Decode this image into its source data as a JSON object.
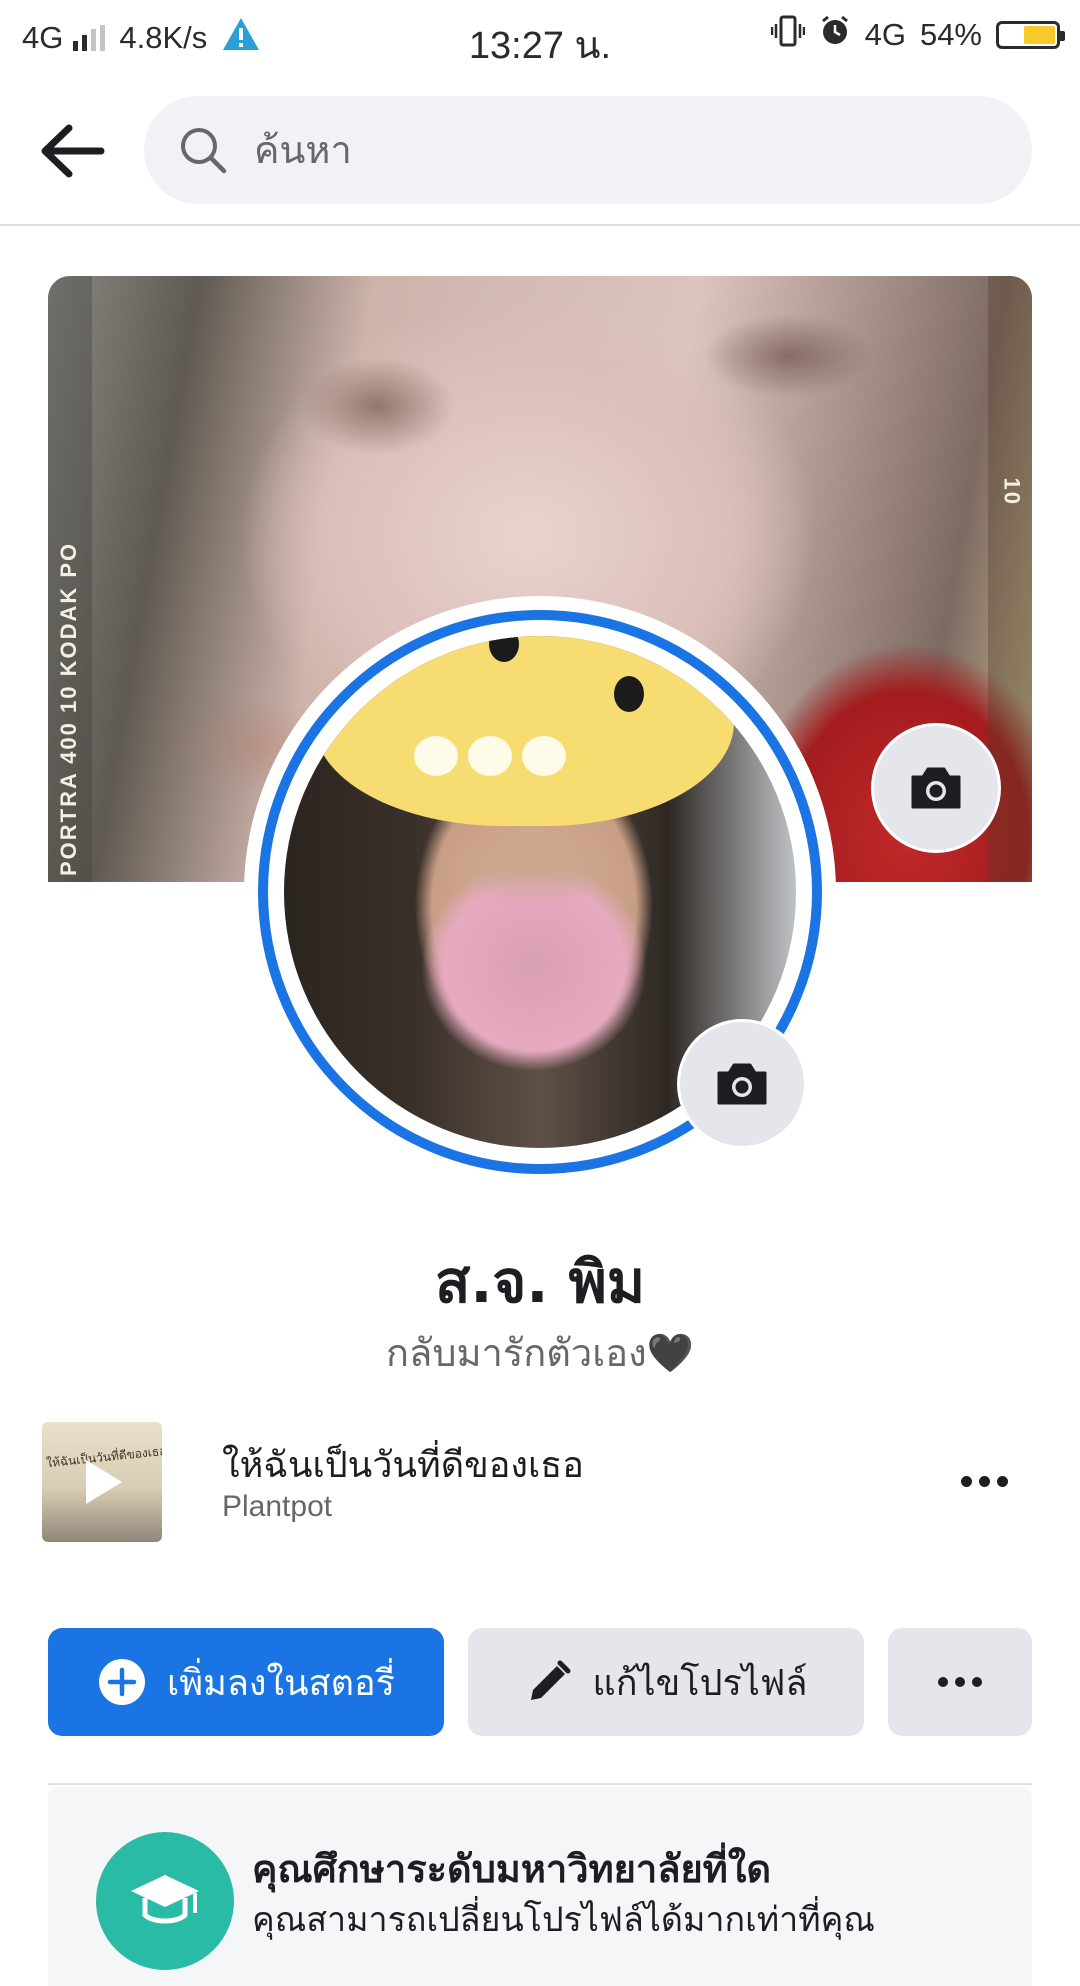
{
  "status_bar": {
    "network": "4G",
    "speed": "4.8K/s",
    "time": "13:27 น.",
    "network_right": "4G",
    "battery": "54%",
    "battery_level": 0.54
  },
  "search": {
    "placeholder": "ค้นหา"
  },
  "cover": {
    "left_strip_text": "PORTRA 400 10 KODAK PO",
    "right_strip_text": "10"
  },
  "profile": {
    "name": "ส.จ. พิม",
    "bio": "กลับมารักตัวเอง",
    "bio_emoji": "🖤"
  },
  "music": {
    "title": "ให้ฉันเป็นวันที่ดีของเธอ",
    "artist": "Plantpot",
    "thumb_text": "ให้ฉันเป็นวันที่ดีของเธอ"
  },
  "actions": {
    "add_story": "เพิ่มลงในสตอรี่",
    "edit_profile": "แก้ไขโปรไฟล์"
  },
  "education_prompt": {
    "title": "คุณศึกษาระดับมหาวิทยาลัยที่ใด",
    "subtitle": "คุณสามารถเปลี่ยนโปรไฟล์ได้มากเท่าที่คุณ"
  },
  "colors": {
    "accent": "#1b74e4",
    "secondary_button": "#e4e6eb",
    "education_icon": "#2abba7"
  },
  "icons": [
    "back-arrow-icon",
    "search-icon",
    "camera-icon",
    "plus-circle-icon",
    "pencil-icon",
    "more-icon",
    "graduation-cap-icon",
    "play-icon"
  ]
}
